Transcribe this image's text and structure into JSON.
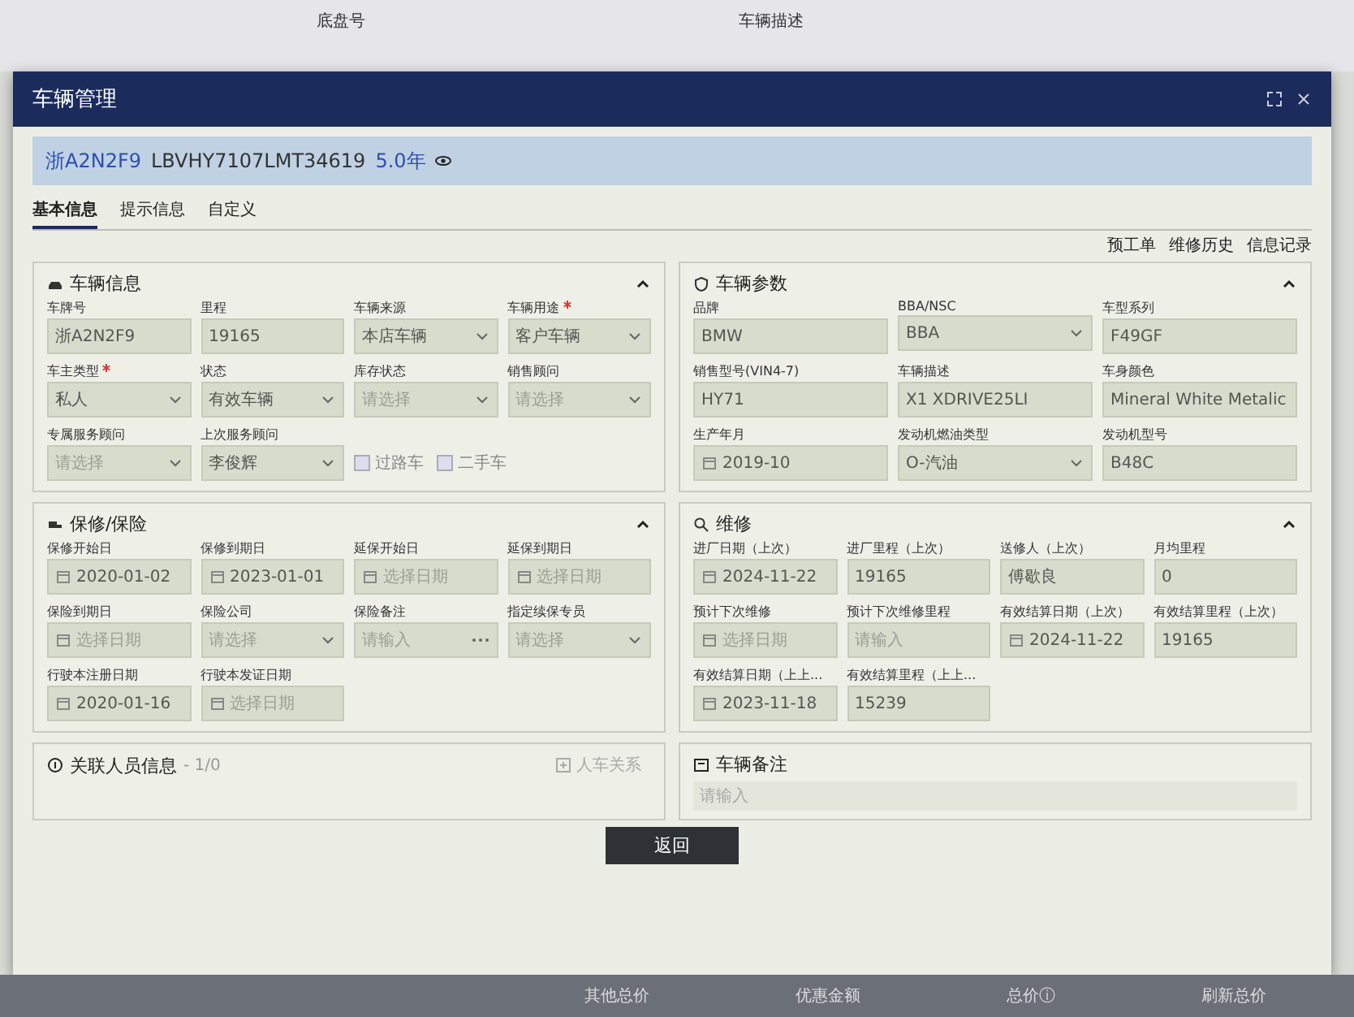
{
  "background": {
    "top_labels": [
      "底盘号",
      "车辆描述"
    ],
    "bottom_labels": [
      "其他总价",
      "优惠金额",
      "总价ⓘ"
    ],
    "refresh": "刷新总价"
  },
  "dialog": {
    "title": "车辆管理",
    "header": {
      "plate": "浙A2N2F9",
      "vin": "LBVHY7107LMT34619",
      "age": "5.0年"
    },
    "tabs": [
      {
        "label": "基本信息",
        "selected": true
      },
      {
        "label": "提示信息",
        "selected": false
      },
      {
        "label": "自定义",
        "selected": false
      }
    ],
    "links": [
      "预工单",
      "维修历史",
      "信息记录"
    ],
    "columns": [
      [
        {
          "title": "车辆信息",
          "rows": [
            [
              {
                "label": "车牌号",
                "kind": "text",
                "value": "浙A2N2F9"
              },
              {
                "label": "里程",
                "kind": "text",
                "value": "19165"
              },
              {
                "label": "车辆来源",
                "kind": "select",
                "value": "本店车辆"
              },
              {
                "label": "车辆用途",
                "required": true,
                "kind": "select",
                "value": "客户车辆"
              }
            ],
            [
              {
                "label": "车主类型",
                "required": true,
                "kind": "select",
                "value": "私人"
              },
              {
                "label": "状态",
                "kind": "select",
                "value": "有效车辆"
              },
              {
                "label": "库存状态",
                "kind": "select",
                "placeholder": "请选择"
              },
              {
                "label": "销售顾问",
                "kind": "select",
                "placeholder": "请选择"
              }
            ],
            [
              {
                "label": "专属服务顾问",
                "kind": "select",
                "placeholder": "请选择"
              },
              {
                "label": "上次服务顾问",
                "kind": "select",
                "value": "李俊辉"
              },
              {
                "kind": "checks",
                "options": [
                  {
                    "label": "过路车",
                    "checked": false
                  },
                  {
                    "label": "二手车",
                    "checked": false
                  }
                ]
              }
            ]
          ]
        },
        {
          "title": "保修/保险",
          "rows": [
            [
              {
                "label": "保修开始日",
                "kind": "date",
                "value": "2020-01-02"
              },
              {
                "label": "保修到期日",
                "kind": "date",
                "value": "2023-01-01"
              },
              {
                "label": "延保开始日",
                "kind": "date",
                "placeholder": "选择日期"
              },
              {
                "label": "延保到期日",
                "kind": "date",
                "placeholder": "选择日期"
              }
            ],
            [
              {
                "label": "保险到期日",
                "kind": "date",
                "placeholder": "选择日期"
              },
              {
                "label": "保险公司",
                "kind": "select",
                "placeholder": "请选择"
              },
              {
                "label": "保险备注",
                "kind": "more",
                "placeholder": "请输入"
              },
              {
                "label": "指定续保专员",
                "kind": "select",
                "placeholder": "请选择"
              }
            ],
            [
              {
                "label": "行驶本注册日期",
                "kind": "date",
                "value": "2020-01-16"
              },
              {
                "label": "行驶本发证日期",
                "kind": "date",
                "placeholder": "选择日期"
              }
            ]
          ]
        }
      ],
      [
        {
          "title": "车辆参数",
          "rows": [
            [
              {
                "label": "品牌",
                "kind": "text",
                "value": "BMW"
              },
              {
                "label": "BBA/NSC",
                "kind": "select",
                "value": "BBA"
              },
              {
                "label": "车型系列",
                "kind": "text",
                "value": "F49GF"
              }
            ],
            [
              {
                "label": "销售型号(VIN4-7)",
                "kind": "text",
                "value": "HY71"
              },
              {
                "label": "车辆描述",
                "kind": "text",
                "value": "X1 XDRIVE25LI"
              },
              {
                "label": "车身颜色",
                "kind": "text",
                "value": "Mineral White Metalic"
              }
            ],
            [
              {
                "label": "生产年月",
                "kind": "date",
                "value": "2019-10"
              },
              {
                "label": "发动机燃油类型",
                "kind": "select",
                "value": "O-汽油"
              },
              {
                "label": "发动机型号",
                "kind": "text",
                "value": "B48C"
              }
            ]
          ]
        },
        {
          "title": "维修",
          "rows": [
            [
              {
                "label": "进厂日期（上次）",
                "kind": "date",
                "value": "2024-11-22"
              },
              {
                "label": "进厂里程（上次）",
                "kind": "text",
                "value": "19165"
              },
              {
                "label": "送修人（上次）",
                "kind": "text",
                "value": "傅歇良"
              },
              {
                "label": "月均里程",
                "kind": "text",
                "value": "0"
              }
            ],
            [
              {
                "label": "预计下次维修",
                "kind": "date",
                "placeholder": "选择日期"
              },
              {
                "label": "预计下次维修里程",
                "kind": "text",
                "placeholder": "请输入"
              },
              {
                "label": "有效结算日期（上次）",
                "kind": "date",
                "value": "2024-11-22"
              },
              {
                "label": "有效结算里程（上次）",
                "kind": "text",
                "value": "19165"
              }
            ],
            [
              {
                "label": "有效结算日期（上上...",
                "kind": "date",
                "value": "2023-11-18"
              },
              {
                "label": "有效结算里程（上上...",
                "kind": "text",
                "value": "15239"
              }
            ]
          ]
        }
      ]
    ],
    "people": {
      "title": "关联人员信息",
      "count": "- 1/0",
      "action": "人车关系"
    },
    "remark": {
      "title": "车辆备注",
      "placeholder": "请输入"
    },
    "back_button": "返回"
  }
}
